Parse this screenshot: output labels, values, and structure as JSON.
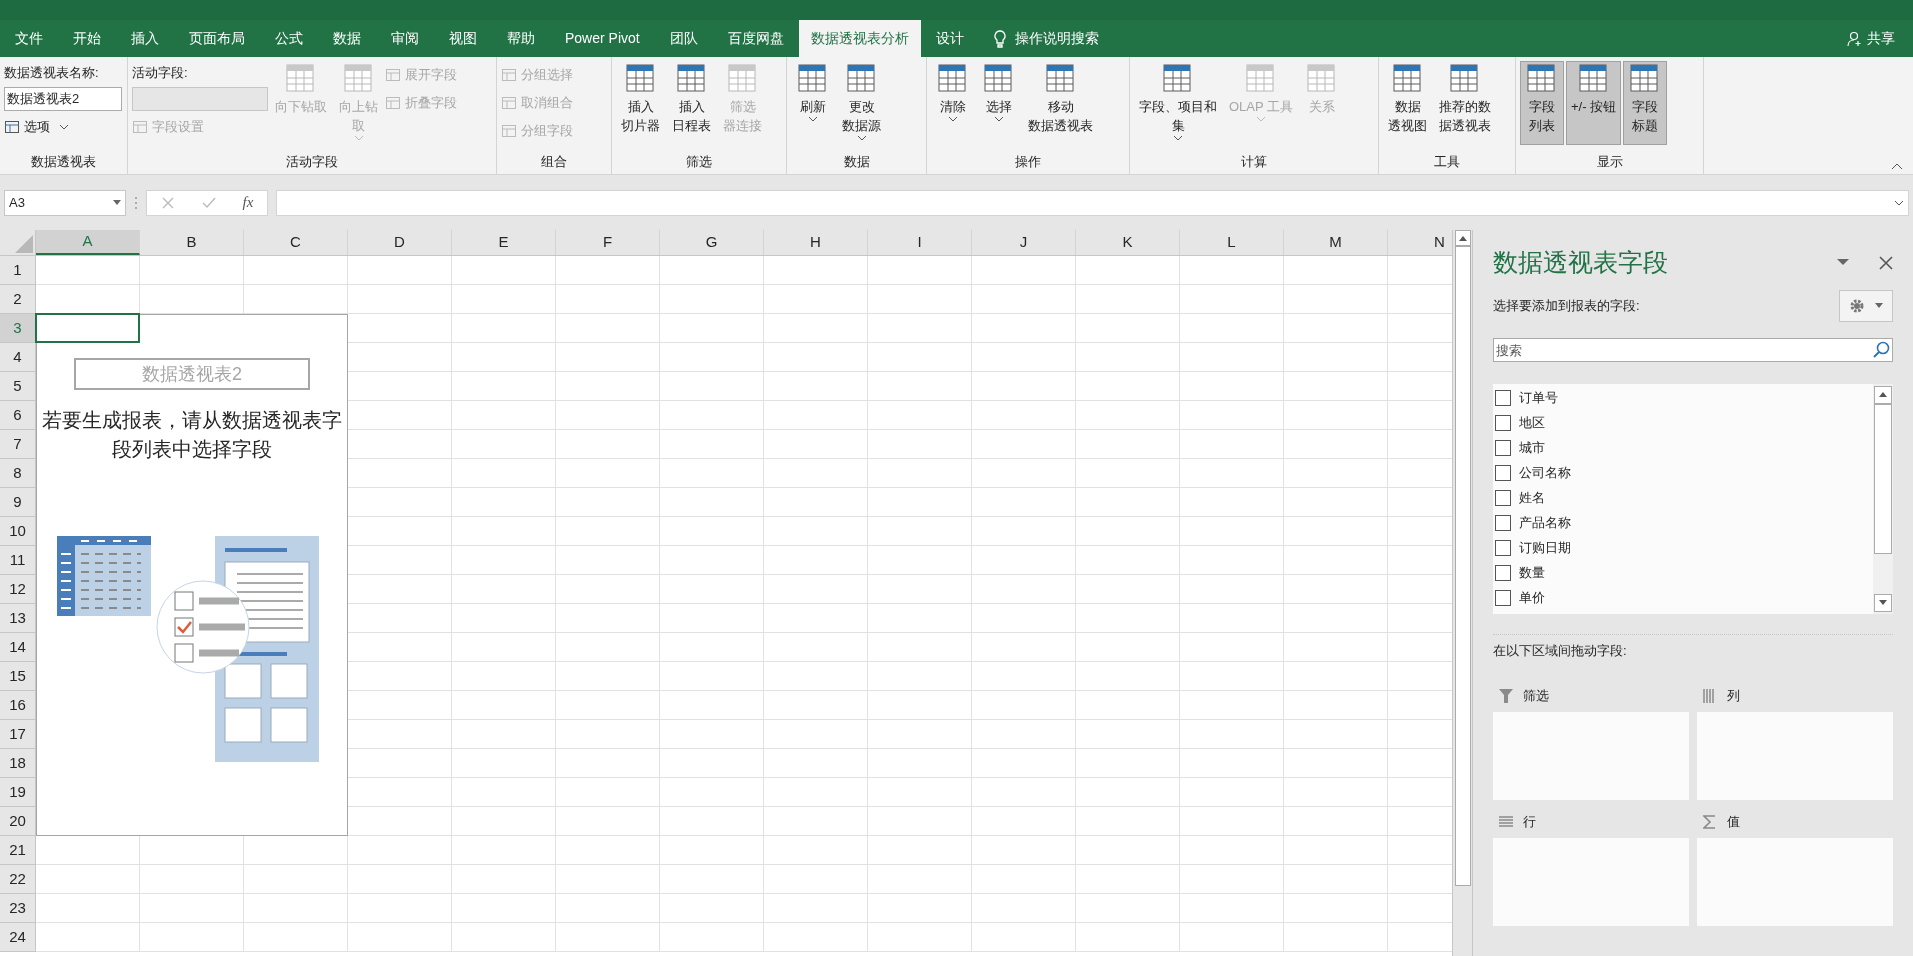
{
  "tabs": [
    {
      "label": "文件",
      "selected": false
    },
    {
      "label": "开始",
      "selected": false
    },
    {
      "label": "插入",
      "selected": false
    },
    {
      "label": "页面布局",
      "selected": false
    },
    {
      "label": "公式",
      "selected": false
    },
    {
      "label": "数据",
      "selected": false
    },
    {
      "label": "审阅",
      "selected": false
    },
    {
      "label": "视图",
      "selected": false
    },
    {
      "label": "帮助",
      "selected": false
    },
    {
      "label": "Power Pivot",
      "selected": false
    },
    {
      "label": "团队",
      "selected": false
    },
    {
      "label": "百度网盘",
      "selected": false
    },
    {
      "label": "数据透视表分析",
      "selected": true
    },
    {
      "label": "设计",
      "selected": false
    }
  ],
  "tell_me": "操作说明搜索",
  "share": "共享",
  "ribbon_groups": [
    {
      "label": "数据透视表",
      "items": [
        {
          "kind": "caption",
          "label": "数据透视表名称:"
        },
        {
          "kind": "field",
          "value": "数据透视表2",
          "disabled": false
        },
        {
          "kind": "small",
          "label": "选项",
          "disabled": false,
          "dropdown": true
        }
      ]
    },
    {
      "label": "活动字段",
      "items": [
        {
          "kind": "caption",
          "label": "活动字段:"
        },
        {
          "kind": "field",
          "value": "",
          "disabled": true
        },
        {
          "kind": "small",
          "label": "字段设置",
          "disabled": true,
          "dropdown": false
        },
        {
          "kind": "large",
          "lines": [
            "向下钻取"
          ],
          "disabled": true,
          "dropdown": false,
          "selected": false
        },
        {
          "kind": "large",
          "lines": [
            "向上钻",
            "取"
          ],
          "disabled": true,
          "dropdown": true,
          "selected": false
        },
        {
          "kind": "small",
          "label": "展开字段",
          "disabled": true,
          "dropdown": false
        },
        {
          "kind": "small",
          "label": "折叠字段",
          "disabled": true,
          "dropdown": false
        }
      ]
    },
    {
      "label": "组合",
      "items": [
        {
          "kind": "small",
          "label": "分组选择",
          "disabled": true,
          "dropdown": false
        },
        {
          "kind": "small",
          "label": "取消组合",
          "disabled": true,
          "dropdown": false
        },
        {
          "kind": "small",
          "label": "分组字段",
          "disabled": true,
          "dropdown": false
        }
      ]
    },
    {
      "label": "筛选",
      "items": [
        {
          "kind": "large",
          "lines": [
            "插入",
            "切片器"
          ],
          "disabled": false,
          "dropdown": false,
          "selected": false
        },
        {
          "kind": "large",
          "lines": [
            "插入",
            "日程表"
          ],
          "disabled": false,
          "dropdown": false,
          "selected": false
        },
        {
          "kind": "large",
          "lines": [
            "筛选",
            "器连接"
          ],
          "disabled": true,
          "dropdown": false,
          "selected": false
        }
      ]
    },
    {
      "label": "数据",
      "items": [
        {
          "kind": "large",
          "lines": [
            "刷新"
          ],
          "disabled": false,
          "dropdown": true,
          "selected": false
        },
        {
          "kind": "large",
          "lines": [
            "更改",
            "数据源"
          ],
          "disabled": false,
          "dropdown": true,
          "selected": false
        }
      ]
    },
    {
      "label": "操作",
      "items": [
        {
          "kind": "large",
          "lines": [
            "清除"
          ],
          "disabled": false,
          "dropdown": true,
          "selected": false
        },
        {
          "kind": "large",
          "lines": [
            "选择"
          ],
          "disabled": false,
          "dropdown": true,
          "selected": false
        },
        {
          "kind": "large",
          "lines": [
            "移动",
            "数据透视表"
          ],
          "disabled": false,
          "dropdown": false,
          "selected": false
        }
      ]
    },
    {
      "label": "计算",
      "items": [
        {
          "kind": "large",
          "lines": [
            "字段、项目和",
            "集"
          ],
          "disabled": false,
          "dropdown": true,
          "selected": false
        },
        {
          "kind": "large",
          "lines": [
            "OLAP 工具"
          ],
          "disabled": true,
          "dropdown": true,
          "selected": false
        },
        {
          "kind": "large",
          "lines": [
            "关系"
          ],
          "disabled": true,
          "dropdown": false,
          "selected": false
        }
      ]
    },
    {
      "label": "工具",
      "items": [
        {
          "kind": "large",
          "lines": [
            "数据",
            "透视图"
          ],
          "disabled": false,
          "dropdown": false,
          "selected": false
        },
        {
          "kind": "large",
          "lines": [
            "推荐的数",
            "据透视表"
          ],
          "disabled": false,
          "dropdown": false,
          "selected": false
        }
      ]
    },
    {
      "label": "显示",
      "items": [
        {
          "kind": "large",
          "lines": [
            "字段",
            "列表"
          ],
          "disabled": false,
          "dropdown": false,
          "selected": true
        },
        {
          "kind": "large",
          "lines": [
            "+/- 按钮"
          ],
          "disabled": false,
          "dropdown": false,
          "selected": true
        },
        {
          "kind": "large",
          "lines": [
            "字段",
            "标题"
          ],
          "disabled": false,
          "dropdown": false,
          "selected": true
        }
      ]
    }
  ],
  "formula_bar": {
    "name_box": "A3",
    "function_button": "fx"
  },
  "sheet": {
    "columns": [
      {
        "label": "A",
        "selected": true
      },
      {
        "label": "B",
        "selected": false
      },
      {
        "label": "C",
        "selected": false
      },
      {
        "label": "D",
        "selected": false
      },
      {
        "label": "E",
        "selected": false
      },
      {
        "label": "F",
        "selected": false
      },
      {
        "label": "G",
        "selected": false
      },
      {
        "label": "H",
        "selected": false
      },
      {
        "label": "I",
        "selected": false
      },
      {
        "label": "J",
        "selected": false
      },
      {
        "label": "K",
        "selected": false
      },
      {
        "label": "L",
        "selected": false
      },
      {
        "label": "M",
        "selected": false
      },
      {
        "label": "N",
        "selected": false
      }
    ],
    "rows": [
      {
        "label": "1",
        "selected": false
      },
      {
        "label": "2",
        "selected": false
      },
      {
        "label": "3",
        "selected": true
      },
      {
        "label": "4",
        "selected": false
      },
      {
        "label": "5",
        "selected": false
      },
      {
        "label": "6",
        "selected": false
      },
      {
        "label": "7",
        "selected": false
      },
      {
        "label": "8",
        "selected": false
      },
      {
        "label": "9",
        "selected": false
      },
      {
        "label": "10",
        "selected": false
      },
      {
        "label": "11",
        "selected": false
      },
      {
        "label": "12",
        "selected": false
      },
      {
        "label": "13",
        "selected": false
      },
      {
        "label": "14",
        "selected": false
      },
      {
        "label": "15",
        "selected": false
      },
      {
        "label": "16",
        "selected": false
      },
      {
        "label": "17",
        "selected": false
      },
      {
        "label": "18",
        "selected": false
      },
      {
        "label": "19",
        "selected": false
      },
      {
        "label": "20",
        "selected": false
      },
      {
        "label": "21",
        "selected": false
      },
      {
        "label": "22",
        "selected": false
      },
      {
        "label": "23",
        "selected": false
      },
      {
        "label": "24",
        "selected": false
      }
    ],
    "pivot_placeholder": {
      "title": "数据透视表2",
      "instruction": "若要生成报表，请从数据透视表字段列表中选择字段"
    }
  },
  "field_pane": {
    "title": "数据透视表字段",
    "subtitle": "选择要添加到报表的字段:",
    "search": {
      "placeholder": "搜索"
    },
    "fields": [
      {
        "label": "订单号",
        "checked": false
      },
      {
        "label": "地区",
        "checked": false
      },
      {
        "label": "城市",
        "checked": false
      },
      {
        "label": "公司名称",
        "checked": false
      },
      {
        "label": "姓名",
        "checked": false
      },
      {
        "label": "产品名称",
        "checked": false
      },
      {
        "label": "订购日期",
        "checked": false
      },
      {
        "label": "数量",
        "checked": false
      },
      {
        "label": "单价",
        "checked": false
      }
    ],
    "drag_label": "在以下区域间拖动字段:",
    "areas": [
      {
        "kind": "filter",
        "label": "筛选"
      },
      {
        "kind": "columns",
        "label": "列"
      },
      {
        "kind": "rows",
        "label": "行"
      },
      {
        "kind": "values",
        "label": "值"
      }
    ]
  }
}
